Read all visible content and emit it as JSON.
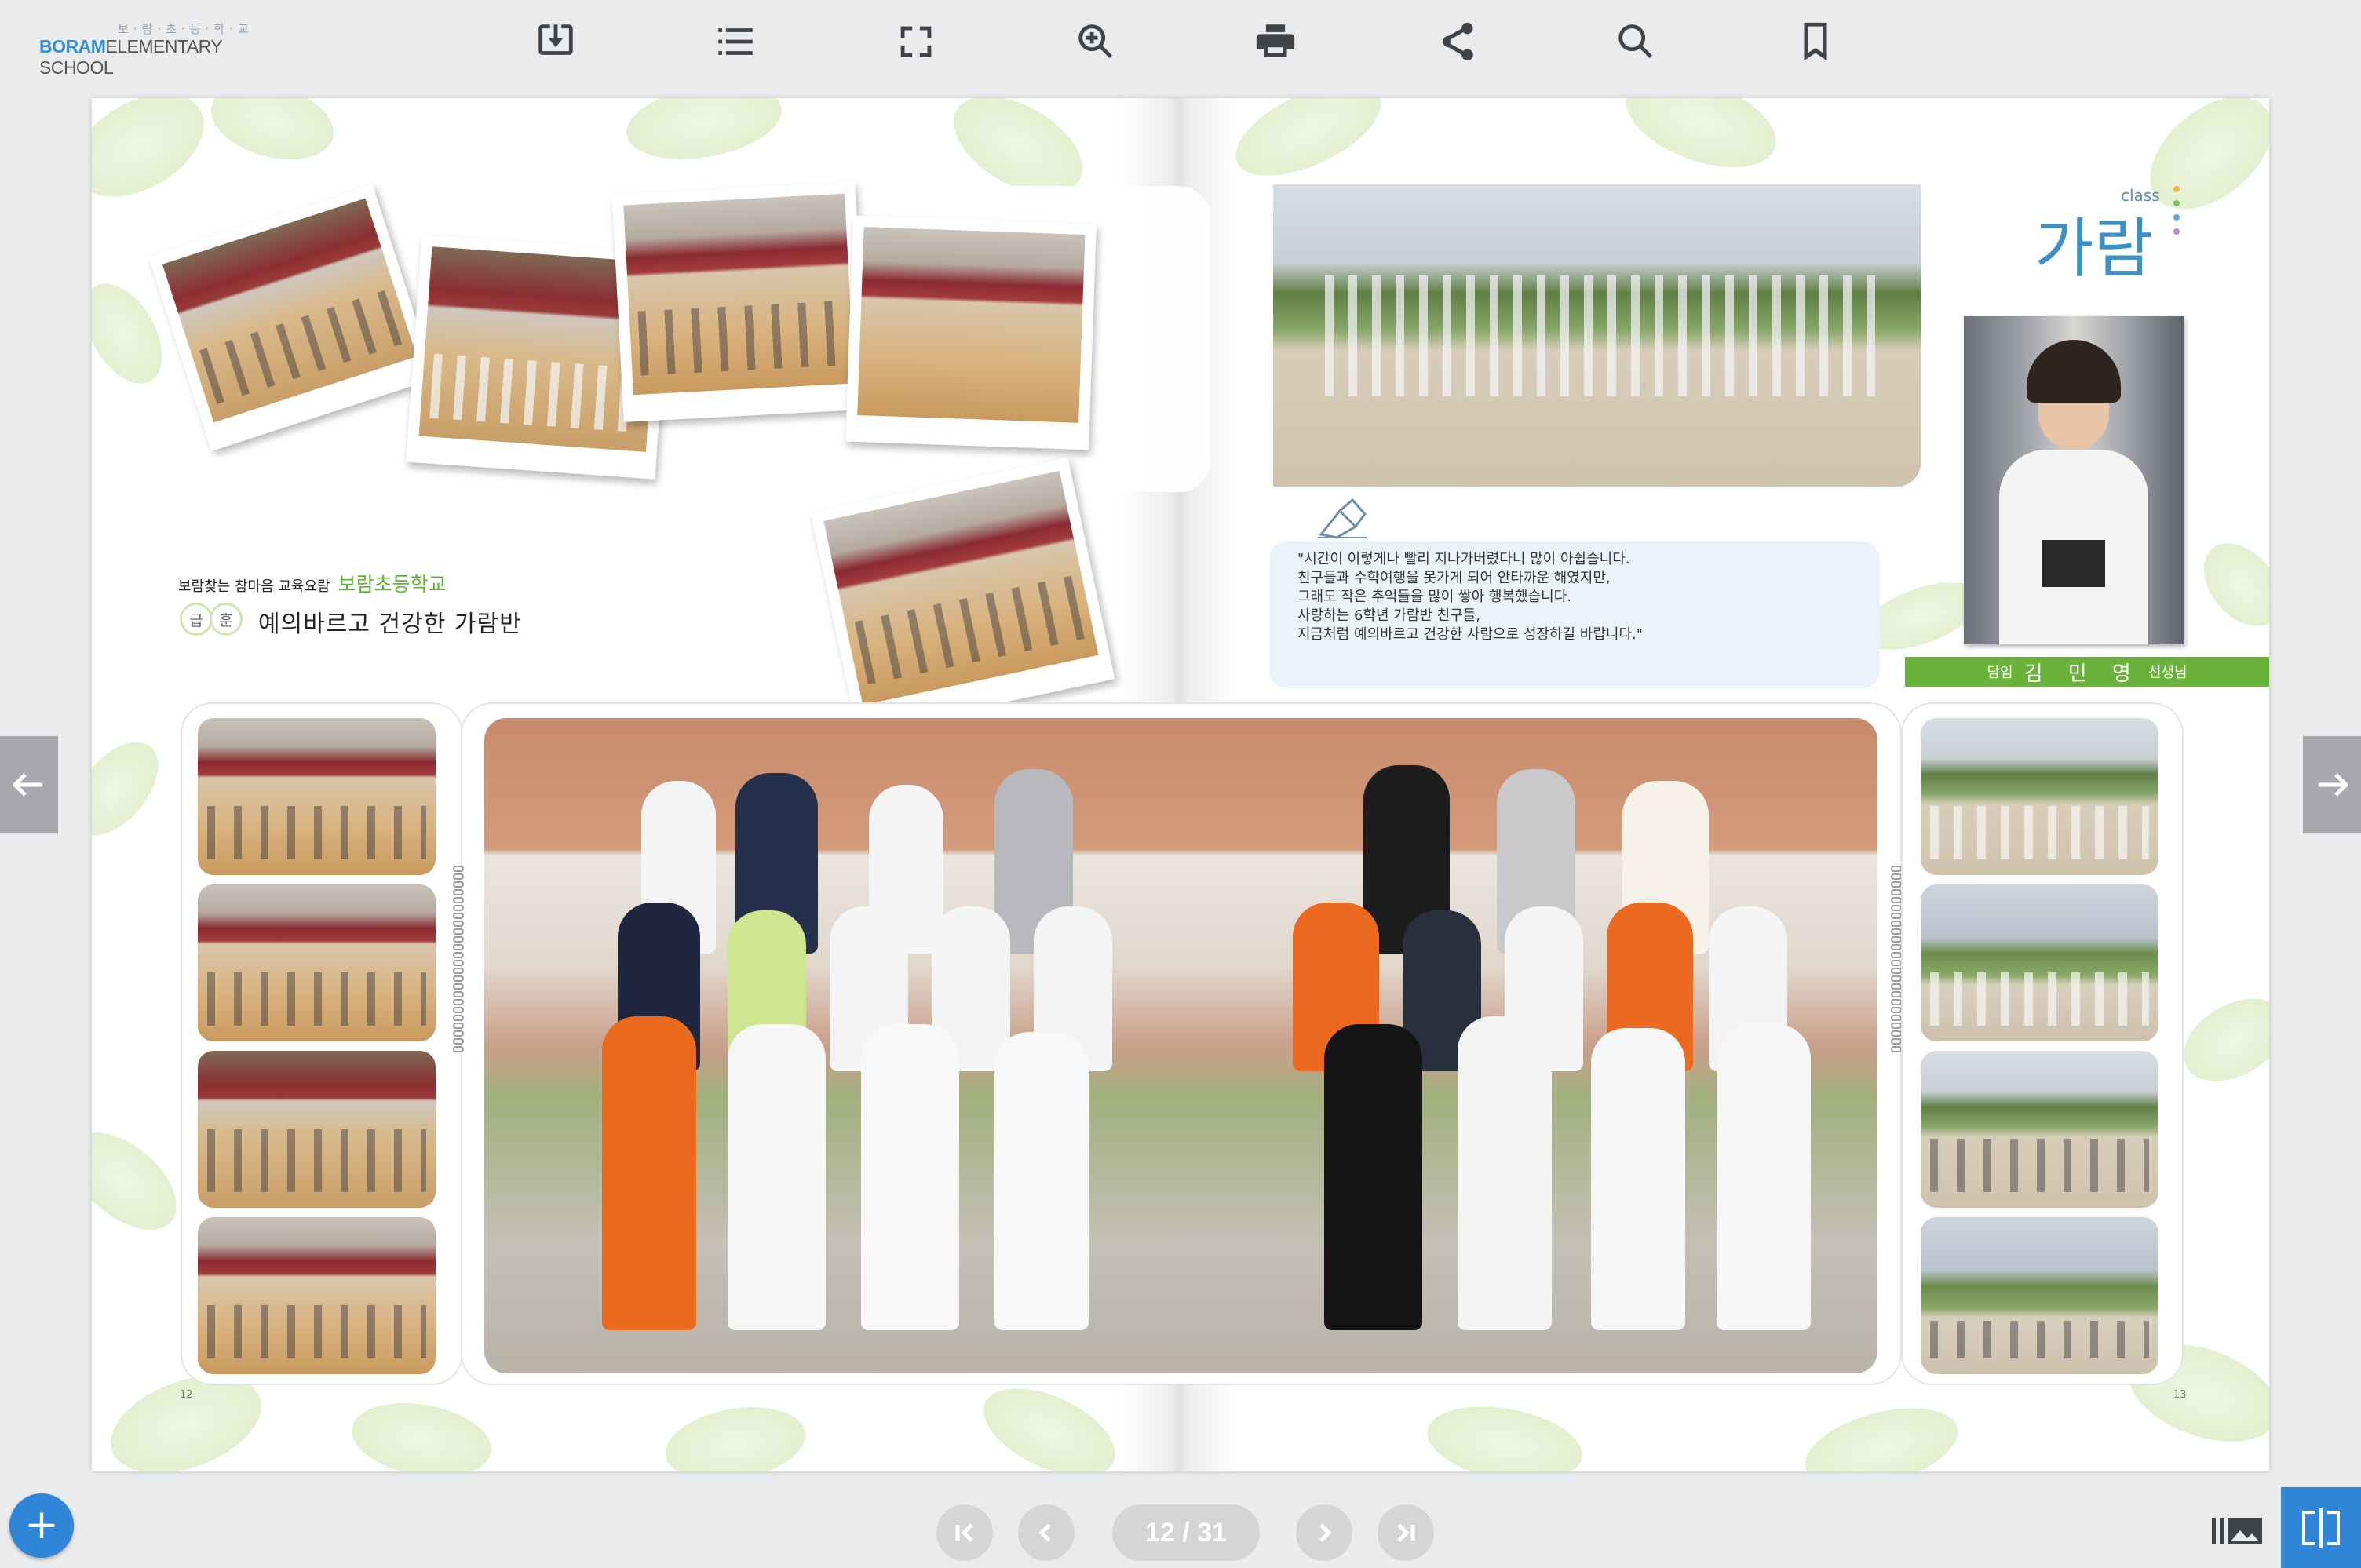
{
  "header": {
    "logo_korean": "보·람·초·등·학·교",
    "logo_brand": "BORAM",
    "logo_rest": "ELEMENTARY SCHOOL"
  },
  "toolbar": [
    {
      "name": "download-icon"
    },
    {
      "name": "table-of-contents-icon"
    },
    {
      "name": "fullscreen-icon"
    },
    {
      "name": "zoom-in-icon"
    },
    {
      "name": "print-icon"
    },
    {
      "name": "share-icon"
    },
    {
      "name": "search-icon"
    },
    {
      "name": "bookmark-icon"
    }
  ],
  "left_page": {
    "subtitle_prefix": "보람찾는 참마음 교육요람",
    "subtitle_school": "보람초등학교",
    "badge_1": "급",
    "badge_2": "훈",
    "motto": "예의바르고 건강한 가람반",
    "page_number": "12"
  },
  "right_page": {
    "class_tag": "class",
    "class_name": "가람",
    "message_lines": [
      "\"시간이 이렇게나 빨리 지나가버렸다니 많이 아쉽습니다.",
      "친구들과 수학여행을 못가게 되어 안타까운 해였지만,",
      "그래도 작은 추억들을 많이 쌓아 행복했습니다.",
      "사랑하는 6학년 가람반 친구들,",
      "지금처럼 예의바르고 건강한 사람으로 성장하길 바랍니다.\""
    ],
    "teacher_role": "담임",
    "teacher_name": "김 민 영",
    "teacher_suffix": "선생님",
    "page_number": "13"
  },
  "navigation": {
    "page_indicator": "12 / 31",
    "current_page": 12,
    "total_pages": 31
  },
  "colors": {
    "accent_blue": "#2f86d8",
    "class_blue": "#3d8fc8",
    "teacher_bar_green": "#6ab33a",
    "school_green": "#5db532",
    "nav_gray": "#d4d5d7"
  }
}
